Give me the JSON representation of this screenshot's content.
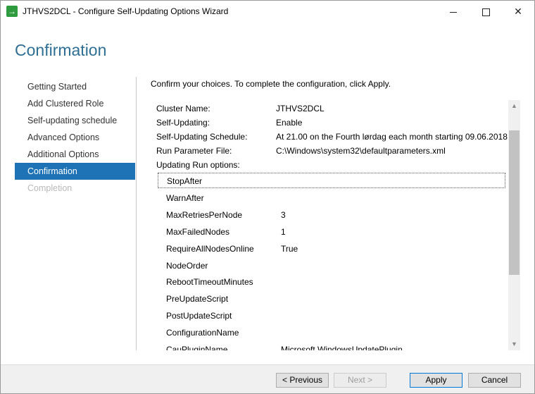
{
  "window": {
    "title": "JTHVS2DCL - Configure Self-Updating Options Wizard"
  },
  "page": {
    "title": "Confirmation",
    "intro": "Confirm your choices. To complete the configuration, click Apply."
  },
  "nav": {
    "items": [
      {
        "label": "Getting Started",
        "state": "normal"
      },
      {
        "label": "Add Clustered Role",
        "state": "normal"
      },
      {
        "label": "Self-updating schedule",
        "state": "normal"
      },
      {
        "label": "Advanced Options",
        "state": "normal"
      },
      {
        "label": "Additional Options",
        "state": "normal"
      },
      {
        "label": "Confirmation",
        "state": "active"
      },
      {
        "label": "Completion",
        "state": "disabled"
      }
    ]
  },
  "summary": {
    "rows": [
      {
        "label": "Cluster Name:",
        "value": "JTHVS2DCL"
      },
      {
        "label": "Self-Updating:",
        "value": "Enable"
      },
      {
        "label": "Self-Updating Schedule:",
        "value": "At 21.00 on the Fourth lørdag each month starting 09.06.2018"
      },
      {
        "label": "Run Parameter File:",
        "value": "C:\\Windows\\system32\\defaultparameters.xml"
      }
    ],
    "options_label": "Updating Run options:",
    "options": [
      {
        "name": "StopAfter",
        "value": ""
      },
      {
        "name": "WarnAfter",
        "value": ""
      },
      {
        "name": "MaxRetriesPerNode",
        "value": "3"
      },
      {
        "name": "MaxFailedNodes",
        "value": "1"
      },
      {
        "name": "RequireAllNodesOnline",
        "value": "True"
      },
      {
        "name": "NodeOrder",
        "value": ""
      },
      {
        "name": "RebootTimeoutMinutes",
        "value": ""
      },
      {
        "name": "PreUpdateScript",
        "value": ""
      },
      {
        "name": "PostUpdateScript",
        "value": ""
      },
      {
        "name": "ConfigurationName",
        "value": ""
      },
      {
        "name": "CauPluginName",
        "value": "Microsoft.WindowsUpdatePlugin"
      }
    ]
  },
  "buttons": {
    "previous": "< Previous",
    "next": "Next >",
    "apply": "Apply",
    "cancel": "Cancel"
  },
  "colors": {
    "accent": "#1e73b6",
    "title": "#2f6f93"
  }
}
